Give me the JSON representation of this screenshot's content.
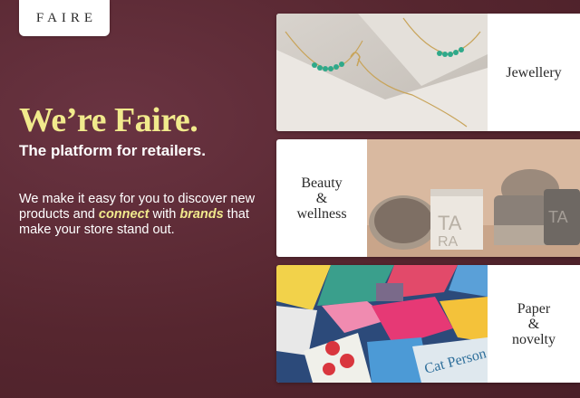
{
  "brand": {
    "logo_text": "FAIRE"
  },
  "hero": {
    "title": "We’re Faire.",
    "subtitle": "The platform for retailers.",
    "body_part1": "We make it easy for you to discover new products and ",
    "body_highlight1": "connect",
    "body_part2": " with ",
    "body_highlight2": "brands",
    "body_part3": " that make your store stand out."
  },
  "categories": [
    {
      "label_lines": [
        "Jewellery"
      ],
      "image": "jewellery-photo"
    },
    {
      "label_lines": [
        "Beauty",
        "&",
        "wellness"
      ],
      "image": "beauty-products-photo"
    },
    {
      "label_lines": [
        "Paper",
        "&",
        "novelty"
      ],
      "image": "paper-goods-photo"
    }
  ],
  "colors": {
    "background": "#5a2a36",
    "accent_yellow": "#f1ea8c",
    "text_white": "#ffffff"
  }
}
